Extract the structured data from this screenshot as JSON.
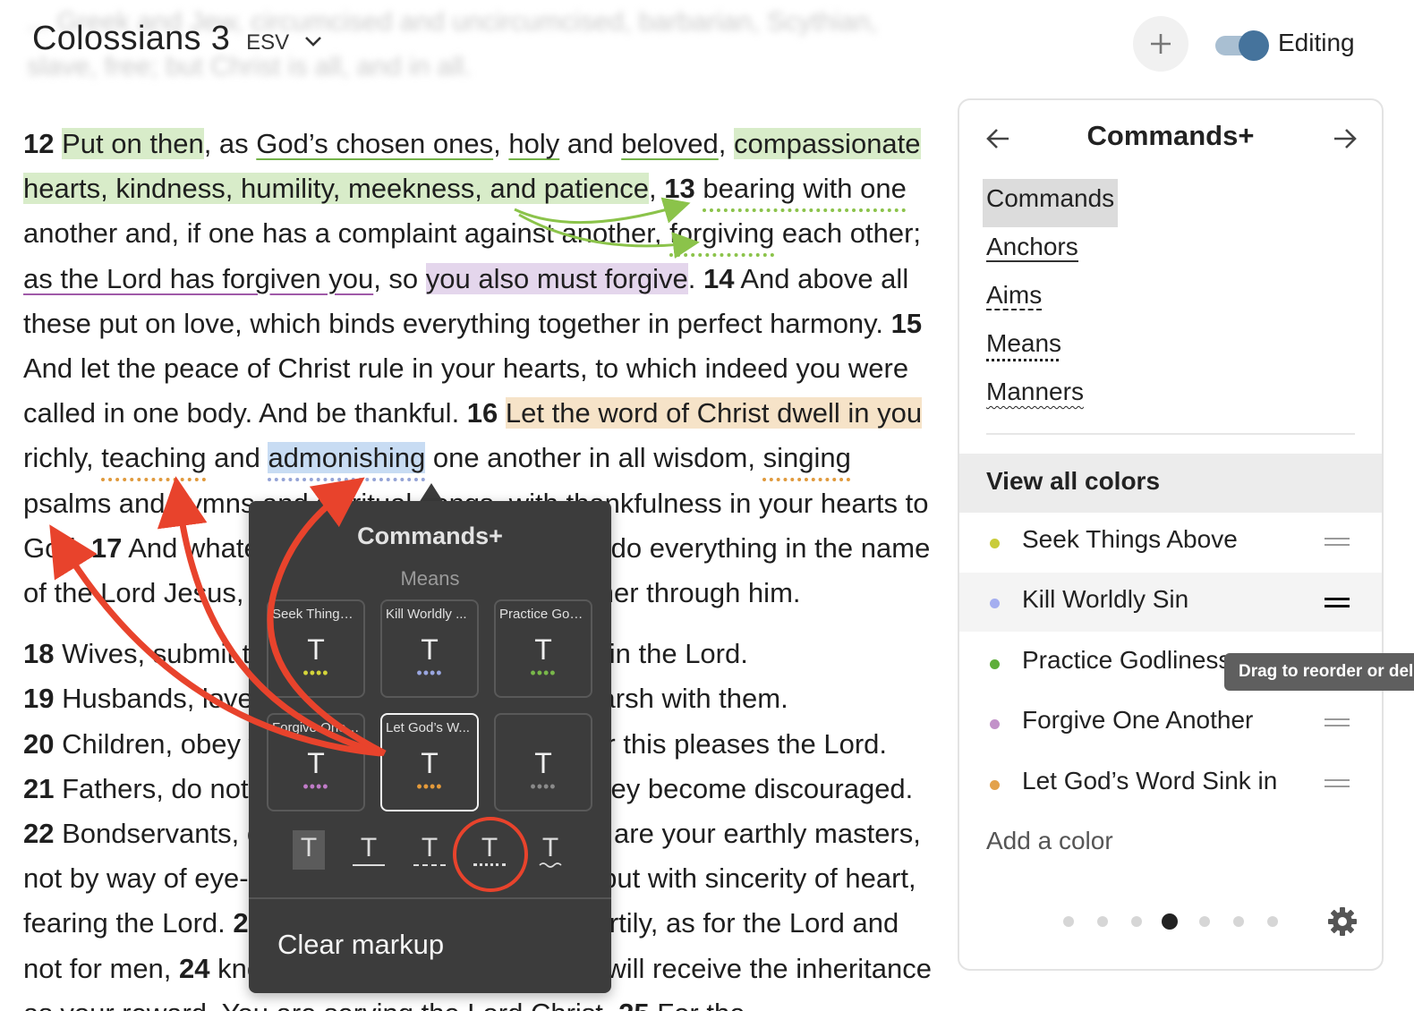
{
  "header": {
    "title": "Colossians 3",
    "version": "ESV",
    "editing_label": "Editing",
    "faded_text": "... Greek and Jew, circumcised and uncircumcised, barbarian, Scythian, slave, free; but Christ is all, and in all."
  },
  "passage": {
    "v12_num": "12",
    "v12_a": "Put on then",
    "v12_b": ", as ",
    "v12_c": "God’s chosen ones",
    "v12_d": ", ",
    "v12_e": "holy",
    "v12_f": " and ",
    "v12_g": "beloved",
    "v12_h": ", ",
    "v12_i": "compassionate hearts, kindness, humility, meekness, and patience",
    "v12_j": ", ",
    "v13_num": "13",
    "v13_a": " ",
    "v13_b": "bearing with one",
    "v13_c": " another and, if one has a complaint against another, ",
    "v13_d": "forgiving",
    "v13_e": " each other; ",
    "v13_f": "as the Lord has forgiven you",
    "v13_g": ", so ",
    "v13_h": "you also must forgive",
    "v13_i": ". ",
    "v14_num": "14",
    "v14_a": " And above all these put on love, which binds everything together in perfect harmony. ",
    "v15_num": "15",
    "v15_a": " And let the peace of Christ rule in your hearts, to which indeed you were called in one body. And be thankful. ",
    "v16_num": "16",
    "v16_a": " ",
    "v16_b": "Let the word of Christ dwell in you",
    "v16_c": " richly, ",
    "v16_d": "teaching",
    "v16_e": " and ",
    "v16_f": "admonishing",
    "v16_g": " one another in all wisdom, ",
    "v16_h": "singing",
    "v16_i": " psalms and hymns and spiritual songs, with thankfulness in your hearts to God. ",
    "v17_num": "17",
    "v17_a": " And whatever you do, in word or deed, do everything in the name of the Lord Jesus, giving thanks to God the Father through him.",
    "v18_num": "18",
    "v18_a": " Wives, submit to your husbands, as is fitting in the Lord.",
    "v19_num": "19",
    "v19_a": " Husbands, love your wives, and do not be harsh with them.",
    "v20_num": "20",
    "v20_a": " Children, obey your parents in everything, for this pleases the Lord.",
    "v21_num": "21",
    "v21_a": " Fathers, do not provoke your children, lest they become discouraged.",
    "v22_num": "22",
    "v22_a": " Bondservants, obey in everything those who are your earthly masters, not by way of eye-service, as people-pleasers, but with sincerity of heart, fearing the Lord. ",
    "v23_num": "23",
    "v23_a": " Whatever you do, work heartily, as for the Lord and not for men, ",
    "v24_num": "24",
    "v24_a": " knowing that from the Lord you will receive the inheritance as your reward. You are serving the Lord Christ. ",
    "v25_num": "25",
    "v25_a": " For the"
  },
  "popup": {
    "title": "Commands+",
    "subtitle": "Means",
    "tiles": [
      {
        "label": "Seek Things ...",
        "glyph": "T",
        "dots": "••••",
        "dot_color": "#d4d43a"
      },
      {
        "label": "Kill Worldly ...",
        "glyph": "T",
        "dots": "••••",
        "dot_color": "#9aa6e0"
      },
      {
        "label": "Practice God...",
        "glyph": "T",
        "dots": "••••",
        "dot_color": "#79b84a"
      },
      {
        "label": "Forgive One ...",
        "glyph": "T",
        "dots": "••••",
        "dot_color": "#c07bc8"
      },
      {
        "label": "Let God’s W...",
        "glyph": "T",
        "dots": "••••",
        "dot_color": "#e49a3a"
      },
      {
        "label": "",
        "glyph": "T",
        "dots": "••••",
        "dot_color": "#8a8a8a"
      }
    ],
    "styles": [
      "T",
      "T",
      "T",
      "T",
      "T"
    ],
    "clear_label": "Clear markup"
  },
  "panel": {
    "title": "Commands+",
    "lenses": [
      "Commands",
      "Anchors",
      "Aims",
      "Means",
      "Manners"
    ],
    "view_all": "View all colors",
    "colors": [
      {
        "name": "Seek Things Above",
        "color": "#c9cc3a"
      },
      {
        "name": "Kill Worldly Sin",
        "color": "#a4aef0"
      },
      {
        "name": "Practice Godliness",
        "color": "#5fae3a"
      },
      {
        "name": "Forgive One Another",
        "color": "#c291c9"
      },
      {
        "name": "Let God’s Word Sink in",
        "color": "#e3a24b"
      }
    ],
    "add_color": "Add a color",
    "tooltip": "Drag to reorder or delete",
    "page_dots": 7,
    "active_page": 4
  },
  "icons": {
    "add": "plus-icon",
    "chevron": "chevron-down-icon",
    "back": "arrow-left-icon",
    "forward": "arrow-right-icon",
    "settings": "gear-icon",
    "drag": "drag-handle-icon"
  }
}
